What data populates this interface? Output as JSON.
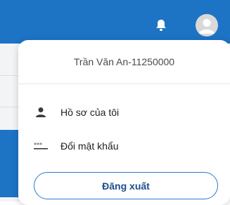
{
  "header": {
    "notification_icon": "bell-icon",
    "avatar_icon": "user-avatar-icon"
  },
  "user_menu": {
    "display_name": "Trần Văn An-11250000",
    "items": [
      {
        "label": "Hồ sơ của tôi",
        "icon": "user-icon"
      },
      {
        "label": "Đổi mật khẩu",
        "icon": "password-icon"
      }
    ],
    "logout_label": "Đăng xuất"
  },
  "colors": {
    "header_bg": "#1d73c4",
    "logout_border": "#2a7bd2",
    "logout_text": "#1c4e8c"
  }
}
